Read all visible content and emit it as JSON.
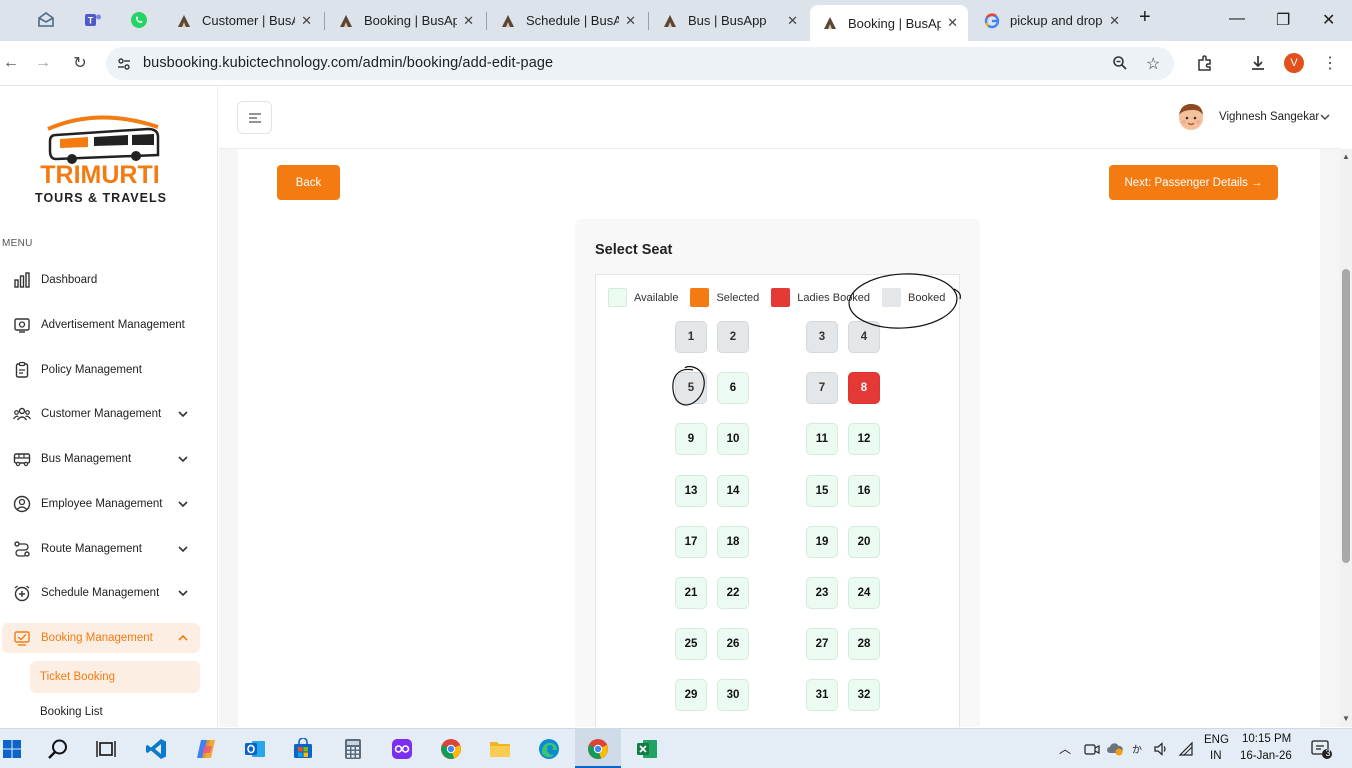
{
  "browser": {
    "tabs": [
      {
        "title": "",
        "icon": "mail-icon"
      },
      {
        "title": "",
        "icon": "teams-icon"
      },
      {
        "title": "",
        "icon": "whatsapp-icon"
      },
      {
        "title": "Customer | BusApp",
        "icon": "busapp-icon"
      },
      {
        "title": "Booking | BusApp",
        "icon": "busapp-icon"
      },
      {
        "title": "Schedule | BusApp",
        "icon": "busapp-icon"
      },
      {
        "title": "Bus | BusApp",
        "icon": "busapp-icon"
      },
      {
        "title": "Booking | BusApp",
        "icon": "busapp-icon",
        "active": true
      },
      {
        "title": "pickup and drop",
        "icon": "google-icon"
      }
    ],
    "url": "busbooking.kubictechnology.com/admin/booking/add-edit-page",
    "profile_initial": "V"
  },
  "sidebar": {
    "logo": {
      "brand": "TRIMURTI",
      "tagline": "TOURS & TRAVELS"
    },
    "menu_title": "MENU",
    "items": [
      {
        "label": "Dashboard",
        "icon": "bar-chart-icon",
        "expandable": false
      },
      {
        "label": "Advertisement Management",
        "icon": "advertisement-icon",
        "expandable": false
      },
      {
        "label": "Policy Management",
        "icon": "clipboard-icon",
        "expandable": false
      },
      {
        "label": "Customer Management",
        "icon": "users-icon",
        "expandable": true
      },
      {
        "label": "Bus Management",
        "icon": "bus-icon",
        "expandable": true
      },
      {
        "label": "Employee Management",
        "icon": "user-circle-icon",
        "expandable": true
      },
      {
        "label": "Route Management",
        "icon": "route-icon",
        "expandable": true
      },
      {
        "label": "Schedule Management",
        "icon": "clock-plus-icon",
        "expandable": true
      },
      {
        "label": "Booking Management",
        "icon": "booking-icon",
        "expandable": true,
        "active": true
      }
    ],
    "sub_items": [
      {
        "label": "Ticket Booking",
        "active": true
      },
      {
        "label": "Booking List"
      }
    ]
  },
  "header": {
    "user_name": "Vighnesh Sangekar"
  },
  "page": {
    "back_label": "Back",
    "next_label": "Next: Passenger Details →",
    "seat_title": "Select Seat",
    "legend": [
      {
        "label": "Available",
        "color": "#ecfbf1"
      },
      {
        "label": "Selected",
        "color": "#f47b12"
      },
      {
        "label": "Ladies Booked",
        "color": "#e53935"
      },
      {
        "label": "Booked",
        "color": "#e4e7ea"
      }
    ],
    "seats": [
      {
        "n": "1",
        "status": "booked"
      },
      {
        "n": "2",
        "status": "booked"
      },
      {
        "n": "3",
        "status": "booked"
      },
      {
        "n": "4",
        "status": "booked"
      },
      {
        "n": "5",
        "status": "booked"
      },
      {
        "n": "6",
        "status": "available"
      },
      {
        "n": "7",
        "status": "booked"
      },
      {
        "n": "8",
        "status": "ladies"
      },
      {
        "n": "9",
        "status": "available"
      },
      {
        "n": "10",
        "status": "available"
      },
      {
        "n": "11",
        "status": "available"
      },
      {
        "n": "12",
        "status": "available"
      },
      {
        "n": "13",
        "status": "available"
      },
      {
        "n": "14",
        "status": "available"
      },
      {
        "n": "15",
        "status": "available"
      },
      {
        "n": "16",
        "status": "available"
      },
      {
        "n": "17",
        "status": "available"
      },
      {
        "n": "18",
        "status": "available"
      },
      {
        "n": "19",
        "status": "available"
      },
      {
        "n": "20",
        "status": "available"
      },
      {
        "n": "21",
        "status": "available"
      },
      {
        "n": "22",
        "status": "available"
      },
      {
        "n": "23",
        "status": "available"
      },
      {
        "n": "24",
        "status": "available"
      },
      {
        "n": "25",
        "status": "available"
      },
      {
        "n": "26",
        "status": "available"
      },
      {
        "n": "27",
        "status": "available"
      },
      {
        "n": "28",
        "status": "available"
      },
      {
        "n": "29",
        "status": "available"
      },
      {
        "n": "30",
        "status": "available"
      },
      {
        "n": "31",
        "status": "available"
      },
      {
        "n": "32",
        "status": "available"
      }
    ]
  },
  "taskbar": {
    "lang_top": "ENG",
    "lang_bottom": "IN",
    "time": "10:15 PM",
    "date": "16-Jan-26",
    "notification_count": "3"
  },
  "colors": {
    "accent": "#f47b12",
    "ladies": "#e53935",
    "available": "#ecfbf1",
    "booked": "#e4e7ea"
  }
}
